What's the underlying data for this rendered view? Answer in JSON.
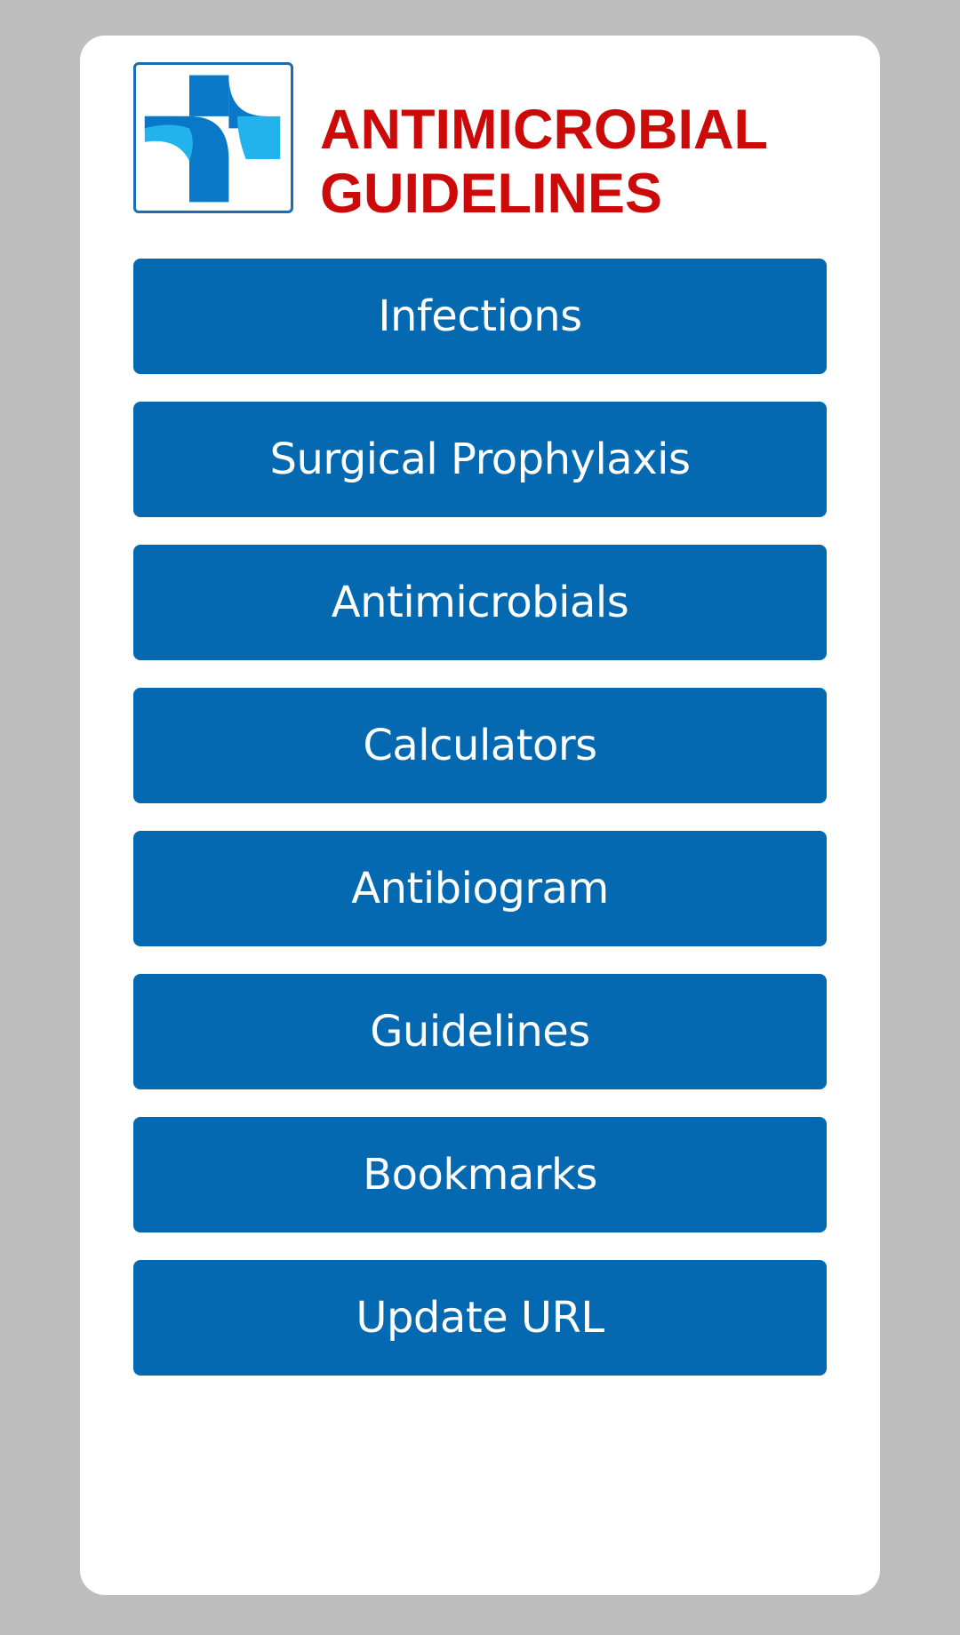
{
  "header": {
    "title_line1": "ANTIMICROBIAL",
    "title_line2": "GUIDELINES",
    "logo_icon": "medical-cross-logo-icon"
  },
  "menu": {
    "items": [
      {
        "label": "Infections"
      },
      {
        "label": "Surgical Prophylaxis"
      },
      {
        "label": "Antimicrobials"
      },
      {
        "label": "Calculators"
      },
      {
        "label": "Antibiogram"
      },
      {
        "label": "Guidelines"
      },
      {
        "label": "Bookmarks"
      },
      {
        "label": "Update URL"
      }
    ]
  },
  "colors": {
    "background": "#bebebe",
    "card": "#ffffff",
    "title": "#cc0a0a",
    "button": "#0469b0",
    "button_text": "#ffffff",
    "logo_dark": "#0a78c8",
    "logo_light": "#22b2ec"
  }
}
